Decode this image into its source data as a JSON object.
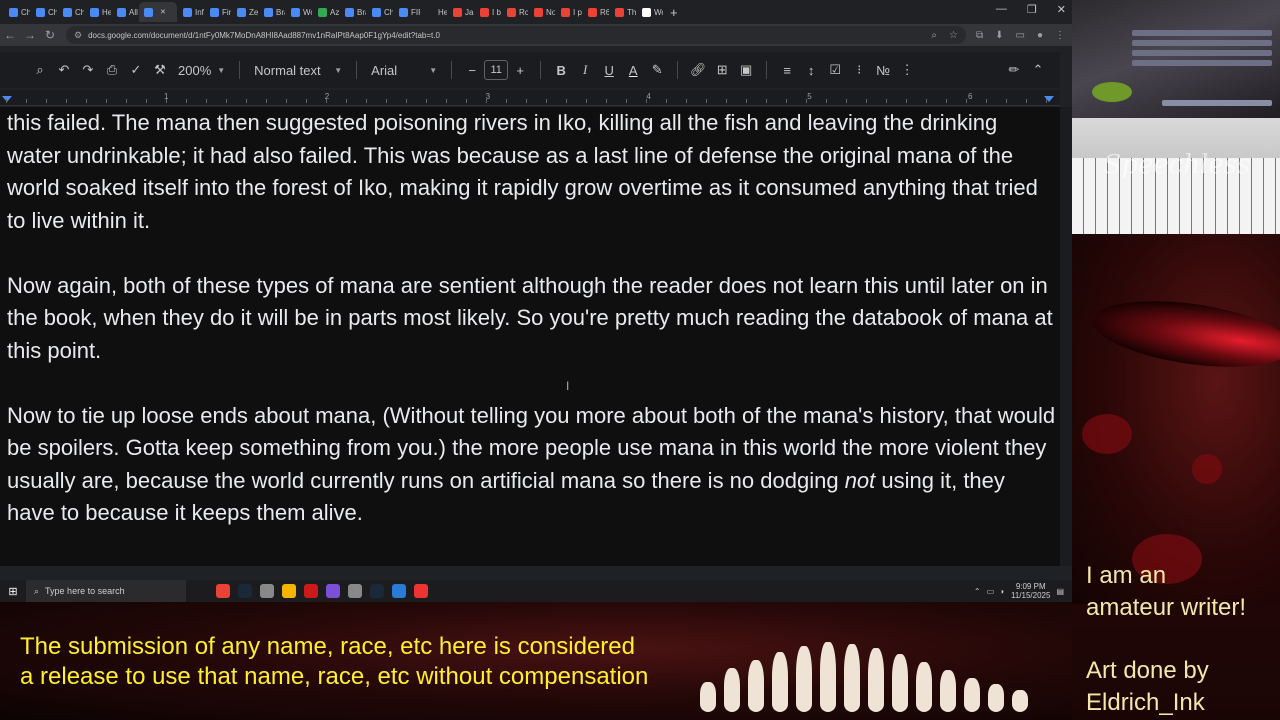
{
  "browser": {
    "tabs": [
      {
        "label": "Cha",
        "color": "#4a8af4"
      },
      {
        "label": "Cha",
        "color": "#4a8af4"
      },
      {
        "label": "Cha",
        "color": "#4a8af4"
      },
      {
        "label": "Hell",
        "color": "#4a8af4"
      },
      {
        "label": "All c",
        "color": "#4a8af4"
      },
      {
        "label": "",
        "color": "#4a8af4",
        "active": true
      },
      {
        "label": "Info",
        "color": "#4a8af4"
      },
      {
        "label": "First",
        "color": "#4a8af4"
      },
      {
        "label": "Zen",
        "color": "#4a8af4"
      },
      {
        "label": "Brai",
        "color": "#4a8af4"
      },
      {
        "label": "Wor",
        "color": "#4a8af4"
      },
      {
        "label": "Azg",
        "color": "#34a853"
      },
      {
        "label": "Brai",
        "color": "#4a8af4"
      },
      {
        "label": "Cha",
        "color": "#4a8af4"
      },
      {
        "label": "FIRS",
        "color": "#4a8af4"
      },
      {
        "label": "Hen",
        "color": "#202124"
      },
      {
        "label": "Jam",
        "color": "#ea4335"
      },
      {
        "label": "I bo",
        "color": "#ea4335"
      },
      {
        "label": "Rob",
        "color": "#ea4335"
      },
      {
        "label": "Nor",
        "color": "#ea4335"
      },
      {
        "label": "I pl",
        "color": "#ea4335"
      },
      {
        "label": "R6 (",
        "color": "#ea4335"
      },
      {
        "label": "The",
        "color": "#ea4335"
      },
      {
        "label": "Wor",
        "color": "#ffffff"
      }
    ],
    "new_tab": "+",
    "url": "docs.google.com/document/d/1ntFy0Mk7MoDnA8HI8Aad887mv1nRaIPt8Aap0F1gYp4/edit?tab=t.0",
    "win_controls": {
      "minimize": "—",
      "restore": "❐",
      "close": "✕"
    }
  },
  "toolbar": {
    "zoom": "200%",
    "style": "Normal text",
    "font": "Arial",
    "font_size": "11",
    "minus": "−",
    "plus": "+",
    "bold": "B",
    "italic": "I",
    "underline": "U",
    "text_color": "A"
  },
  "ruler": {
    "numbers": [
      "1",
      "2",
      "3",
      "4",
      "5",
      "6"
    ]
  },
  "document": {
    "p1": "this failed. The mana then suggested poisoning rivers in Iko, killing all the fish and leaving the drinking water undrinkable; it had also failed. This was because as a last line of defense the original mana of the world soaked itself into the forest of Iko, making it rapidly grow overtime as it consumed anything that tried to live within it.",
    "p2": "Now again, both of these types of mana are sentient although the reader does not learn this until later on in the book, when they do it will be in parts most likely. So you're pretty much reading the databook of mana at this point.",
    "p3_a": "Now to tie up loose ends about mana, (Without telling you more about both of the mana's history, that would be spoilers. Gotta keep something from you.) the more people use mana in this world the more violent they usually are, because the world currently runs on artificial mana so there is no dodging ",
    "p3_em": "not",
    "p3_b": " using it, they have to because it keeps them alive."
  },
  "taskbar": {
    "search_placeholder": "Type here to search",
    "time": "9:09 PM",
    "date": "11/15/2025",
    "app_colors": [
      "#ea4335",
      "#1b2838",
      "#888888",
      "#f4b400",
      "#cc1a1a",
      "#7b4fd6",
      "#888888",
      "#1b2838",
      "#2a7bd6",
      "#e33"
    ]
  },
  "overlay": {
    "piano_logo": "Speechless",
    "promo_line1": "I am an",
    "promo_line2": "amateur writer!",
    "credit_line1": "Art done by",
    "credit_line2": "Eldrich_Ink",
    "disclaimer_line1": "The submission of any name, race, etc here is considered",
    "disclaimer_line2": "a release to use that name, race, etc without compensation"
  }
}
